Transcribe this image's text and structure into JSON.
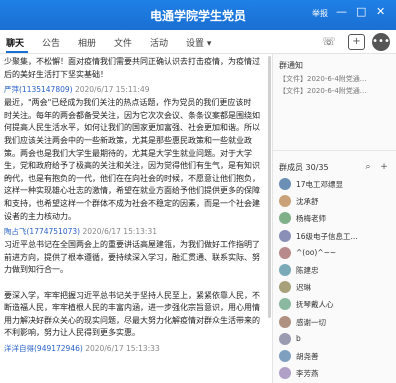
{
  "window": {
    "title": "电通学院学生党员",
    "menu_label": "举报",
    "controls": [
      "—",
      "□",
      "✕"
    ]
  },
  "tabs": [
    "聊天",
    "公告",
    "相册",
    "文件",
    "活动",
    "设置 ▾"
  ],
  "toolbar_icons": [
    "phone-icon",
    "add-icon",
    "more-icon"
  ],
  "messages": [
    {
      "type": "text",
      "lines": [
        "少聚集，不松懈！面对疫情我们需要共同正确认识去打击疫情，为疫情过",
        "后的美好生活打下坚实基础！"
      ]
    },
    {
      "type": "header",
      "name": "严萍",
      "id": "(1135147809)",
      "time": "2020/6/17 15:11:49"
    },
    {
      "type": "text",
      "lines": [
        "最近，\"两会\"已经成为我们关注的热点话题，作为党员的我们更应该时",
        "时关注。每年的两会都备受关注，因为它次次会议、条条议案都是围绕如",
        "何提高人民生活水平，如何让我们的国家更加富强、社会更加和谐。所以",
        "我们应该关注两会中的一些新政策，尤其是那些惠民政策和一些就业政",
        "策。两会也是我们大学生最期待的，尤其是大学生就业问题。对于大学",
        "生，党和政府给予了极高的关注和关注，因为觉得他们有生气，是有知识的",
        "一代，也是有抱负的一代，他们在在向社会的时候，不愿意让他们抱负，",
        "这样一种实现雄心壮志的激情，希望在就业方面给予他们提供更多的保障",
        "和支持，也希望这样一个群体不成为社会不稳定的因素，而是一个社会建",
        "设者的主力核动力。"
      ]
    },
    {
      "type": "header",
      "name": "陶占飞",
      "id": "(1774751073)",
      "time": "2020/6/17 15:13:31"
    },
    {
      "type": "text",
      "lines": [
        "习近平总书记在全国两会上的重要讲话高屋建瓴，为我们做好工作指明了",
        "前进方向，提供了根本遵循，要持续深入学习，融汇贯通、联系实际、努",
        "力做到知行合一。",
        "",
        "要深入学，牢牢把握习近平总书记关于坚持人民至上，紧紧依靠人民，不",
        "断造福人民，牢牢植根人民的丰富内涵，进一步强化宗旨意识，用心用情",
        "用力解决好群众关心的现实问题，尽最大努力化解疫情对群众生活带来的",
        "不利影响，努力让人民得到更多实惠。"
      ]
    },
    {
      "type": "header",
      "name": "洋洋自得",
      "id": "(949172946)",
      "time": "2020/6/17 15:13:33"
    }
  ],
  "sidebar": {
    "notice_title": "群通知",
    "notices": [
      "【文件】2020-6-4附党通...",
      "【文件】2020-6-4附党通..."
    ],
    "members_title": "群成员 30/35",
    "members": [
      "17电工邓缥显",
      "沈承舒",
      "杨梅老师",
      "16级电子信息工...",
      "^(oo)^~~",
      "陈建忠",
      "迟琳",
      "抚琴戴人心",
      "感谢一切",
      "b",
      "胡尧善",
      "李芳燕"
    ]
  }
}
